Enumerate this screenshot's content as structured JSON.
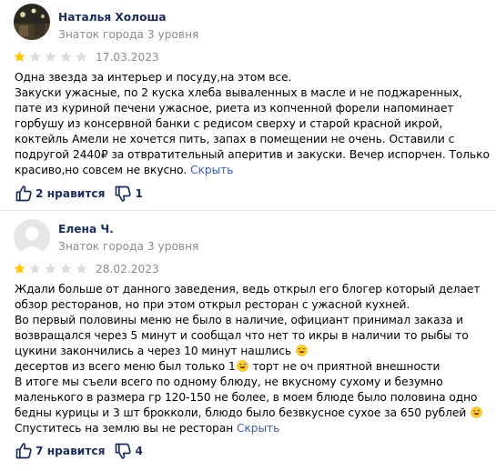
{
  "reviews": [
    {
      "author": "Наталья Холоша",
      "level": "Знаток города 3 уровня",
      "rating": 1,
      "max_rating": 5,
      "date": "17.03.2023",
      "text": "Одна звезда за интерьер и посуду,на этом все.\nЗакуски ужасные, по 2 куска хлеба вываленных в масле и не поджаренных, пате из куриной печени ужасное, риета из копченной форели напоминает горбушу из консервной банки с редисом сверху и старой красной икрой, коктейль Амели не хочется пить, запах в помещении не очень. Оставили с подругой 2440₽ за отвратительный аперитив и закуски. Вечер испорчен. Только красиво,но совсем не вкусно. ",
      "hide_label": "Скрыть",
      "likes_label": "2 нравится",
      "dislikes_label": "1"
    },
    {
      "author": "Елена Ч.",
      "level": "Знаток города 3 уровня",
      "rating": 1,
      "max_rating": 5,
      "date": "28.02.2023",
      "text_parts": [
        "Ждали больше от данного заведения, ведь открыл его блогер который делает обзор ресторанов, но при этом открыл ресторан с ужасной кухней.\nВо первый половины меню не было в наличие, официант принимал заказа и возвращался через 5 минут и сообщал что нет то икры в наличии то рыбы то цукини закончились а через 10 минут нашлись ",
        "\nдесертов из всего меню был только 1",
        " торт не оч приятной внешности\nВ итоге мы съели всего по одному блюду, не вкусному сухому и безумно маленького в размера гр 120-150 не более, в моем блюде было половина одно бедны курицы и 3 шт брокколи, блюдо было безвкусное сухое за 650 рублей ",
        "\nСпуститесь на землю вы не ресторан "
      ],
      "emoji": "grinning-sweat-face",
      "hide_label": "Скрыть",
      "likes_label": "7 нравится",
      "dislikes_label": "4"
    }
  ],
  "colors": {
    "star_filled": "#fec60b",
    "star_empty": "#dcdcdc",
    "link": "#3c5dad",
    "name": "#1c2d59",
    "muted": "#8c8c8c"
  }
}
